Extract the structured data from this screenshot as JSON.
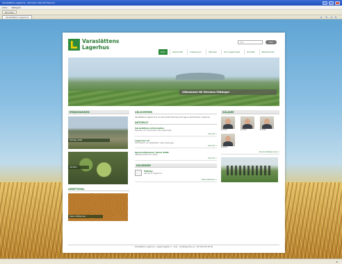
{
  "window": {
    "title": "Varaslättens Lagerhus - Windows Internet Explorer"
  },
  "menubar": {
    "items": [
      "Arkiv",
      "Redigera"
    ]
  },
  "toolbar": {
    "favorites": "Favoriter",
    "tab": "Varaslättens Lagerhus"
  },
  "site": {
    "brand_line1": "Varaslättens",
    "brand_line2": "Lagerhus",
    "search_placeholder": "Sök",
    "search_button": "Sök",
    "nav": [
      "Hem",
      "Spannmål",
      "Insatsvaror",
      "Tjänster",
      "Om Lagerhuset",
      "Kontakt",
      "Medlemmar"
    ],
    "banner_caption": "Välkommen till Värnamo Fältdagar"
  },
  "left": {
    "section_title": "ERBJUDANDEN",
    "pic1_caption": "Fältdag 2008",
    "pic2_caption": "Skolbild",
    "section2_title": "ARBETSMAL",
    "pic3_caption": "Spannmålspriser"
  },
  "mid": {
    "welcome_title": "VÄLKOMMEN",
    "welcome_text": "Varaslättens Lagerhus är en ekonomisk förening som ägs av lantbrukare i regionen.",
    "news_title": "AKTUELLT",
    "news": [
      {
        "title": "Varaslättens information",
        "desc": "Nyheter och information från lagerhuset.",
        "more": "Läs mer »"
      },
      {
        "title": "Lagerhus 15",
        "desc": "Information om öppettider under säsongen.",
        "more": "Läs mer »"
      },
      {
        "title": "Spannmålspriser Skara 2008",
        "desc": "Aktuella priser och villkor.",
        "more": "Läs mer »"
      }
    ],
    "calendar_title": "KALENDER",
    "calendar_event": "Fältdag",
    "calendar_detail": "Värnamo, öppet hus",
    "calendar_more": "Hela kalendern »"
  },
  "right": {
    "section_title": "SÄLJARE",
    "staff": [
      {
        "name": "Kontakt"
      },
      {
        "name": "Kontakt"
      },
      {
        "name": "Kontakt"
      },
      {
        "name": "Kontakt"
      }
    ],
    "staff_more": "Alla kontaktpersoner »"
  },
  "footer": "Varaslättens Lagerhus · Lagerhusgatan 1 · Vara · info@lagerhus.se · Tel 0512-00 00 00"
}
